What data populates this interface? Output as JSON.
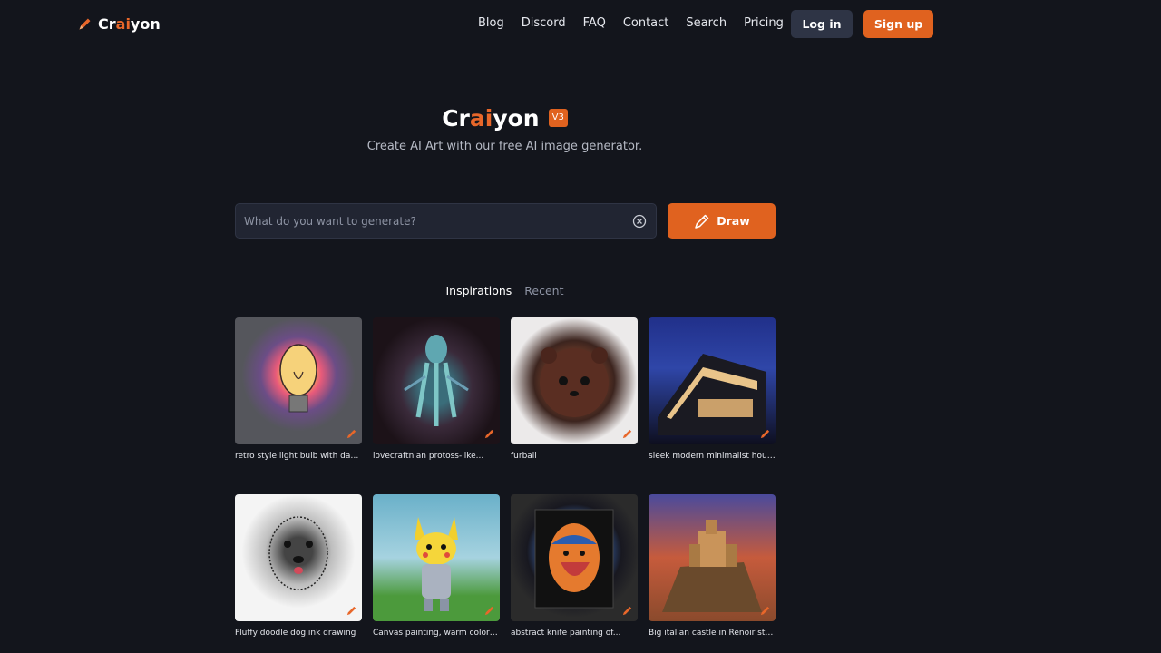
{
  "header": {
    "logo": {
      "prefix": "Cr",
      "highlight": "ai",
      "suffix": "yon"
    },
    "nav": [
      "Blog",
      "Discord",
      "FAQ",
      "Contact",
      "Search",
      "Pricing"
    ],
    "login_label": "Log in",
    "signup_label": "Sign up"
  },
  "hero": {
    "title": {
      "prefix": "Cr",
      "highlight": "ai",
      "suffix": "yon"
    },
    "version_badge": "V3",
    "subtitle": "Create AI Art with our free AI image generator."
  },
  "search": {
    "placeholder": "What do you want to generate?",
    "value": "",
    "draw_label": "Draw"
  },
  "tabs": {
    "inspirations": "Inspirations",
    "recent": "Recent"
  },
  "gallery": [
    {
      "caption": "retro style light bulb with dark..."
    },
    {
      "caption": "lovecraftnian protoss-like..."
    },
    {
      "caption": "furball"
    },
    {
      "caption": "sleek modern minimalist house"
    },
    {
      "caption": "Fluffy doodle dog ink drawing"
    },
    {
      "caption": "Canvas painting, warm colors,..."
    },
    {
      "caption": "abstract knife painting of..."
    },
    {
      "caption": "Big italian castle in Renoir styl..."
    }
  ],
  "colors": {
    "accent": "#e0621f",
    "background": "#13151c",
    "button_dark": "#2e3445"
  }
}
